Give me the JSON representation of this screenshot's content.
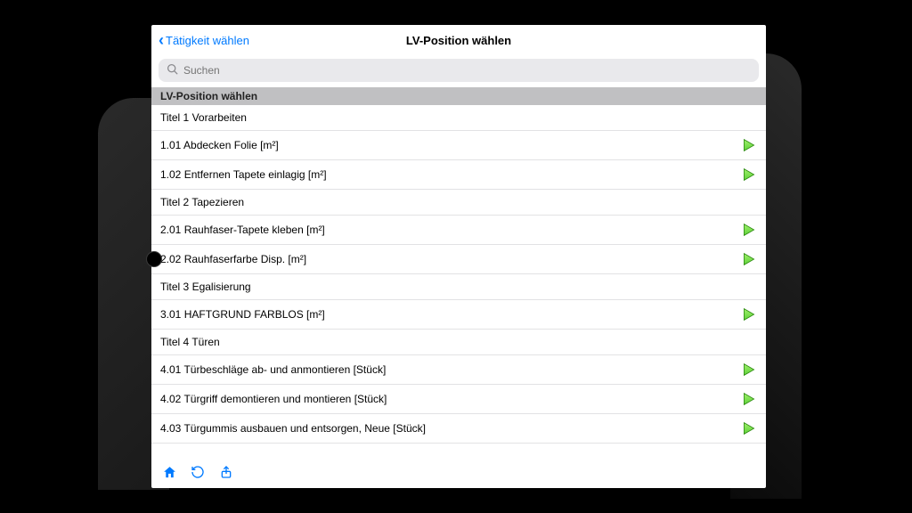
{
  "nav": {
    "back_label": "Tätigkeit wählen",
    "title": "LV-Position wählen"
  },
  "search": {
    "placeholder": "Suchen"
  },
  "section": {
    "header": "LV-Position wählen"
  },
  "rows": [
    {
      "label": "Titel 1 Vorarbeiten",
      "has_play": false
    },
    {
      "label": "1.01 Abdecken Folie [m²]",
      "has_play": true
    },
    {
      "label": "1.02 Entfernen Tapete einlagig [m²]",
      "has_play": true
    },
    {
      "label": "Titel 2 Tapezieren",
      "has_play": false
    },
    {
      "label": "2.01 Rauhfaser-Tapete kleben [m²]",
      "has_play": true
    },
    {
      "label": "2.02 Rauhfaserfarbe Disp. [m²]",
      "has_play": true
    },
    {
      "label": "Titel 3 Egalisierung",
      "has_play": false
    },
    {
      "label": "3.01 HAFTGRUND FARBLOS [m²]",
      "has_play": true
    },
    {
      "label": "Titel 4 Türen",
      "has_play": false
    },
    {
      "label": "4.01 Türbeschläge ab- und anmontieren [Stück]",
      "has_play": true
    },
    {
      "label": "4.02 Türgriff demontieren und montieren [Stück]",
      "has_play": true
    },
    {
      "label": "4.03 Türgummis ausbauen und entsorgen, Neue [Stück]",
      "has_play": true
    }
  ],
  "colors": {
    "accent": "#007aff",
    "play_fill": "#5fd13a",
    "play_stroke": "#2e8a12"
  }
}
